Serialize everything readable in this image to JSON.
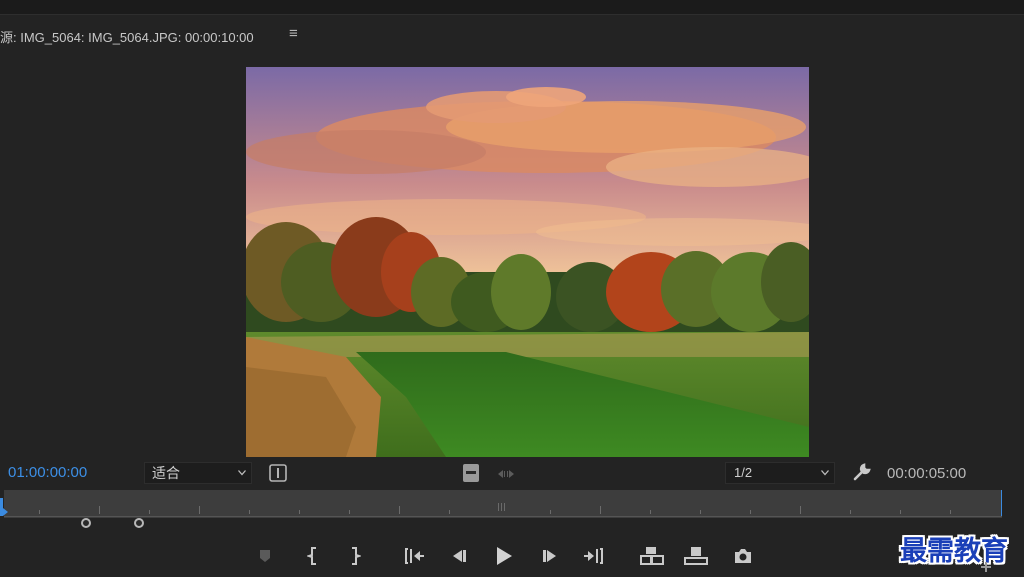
{
  "panel": {
    "title": "源: IMG_5064: IMG_5064.JPG: 00:00:10:00",
    "menu_icon": "hamburger-icon"
  },
  "controls": {
    "current_timecode": "01:00:00:00",
    "zoom_value": "适合",
    "resolution_value": "1/2",
    "duration_timecode": "00:00:05:00"
  },
  "transport": [
    "marker-icon",
    "mark-in-icon",
    "mark-out-icon",
    "go-to-in-icon",
    "step-back-icon",
    "play-icon",
    "step-forward-icon",
    "go-to-out-icon",
    "insert-icon",
    "overwrite-icon",
    "export-frame-icon"
  ],
  "watermark": "最需教育",
  "colors": {
    "background": "#232323",
    "timecode_accent": "#3c8fe6",
    "scrubber": "#3d3d3d",
    "watermark": "#1a3fb8"
  }
}
